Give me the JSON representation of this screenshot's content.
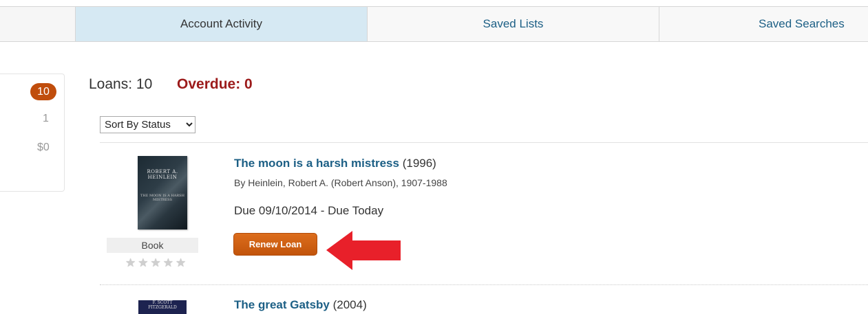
{
  "tabs": {
    "account_activity": "Account Activity",
    "saved_lists": "Saved Lists",
    "saved_searches": "Saved Searches"
  },
  "summary": {
    "loans_badge": "10",
    "holds": "1",
    "fines": "$0"
  },
  "loans_header": {
    "loans": "Loans: 10",
    "overdue": "Overdue: 0"
  },
  "sort": {
    "selected": "Sort By Status"
  },
  "items": [
    {
      "title": "The moon is a harsh mistress",
      "year": "(1996)",
      "author": "By Heinlein, Robert A. (Robert Anson), 1907-1988",
      "due": "Due 09/10/2014 - Due Today",
      "format": "Book",
      "rating": 0,
      "cover_author": "ROBERT A. HEINLEIN",
      "cover_title": "THE MOON IS A HARSH MISTRESS",
      "renew_label": "Renew Loan"
    },
    {
      "title": "The great Gatsby",
      "year": "(2004)",
      "cover_author": "F. SCOTT FITZGERALD"
    }
  ],
  "colors": {
    "accent_orange": "#c2540b",
    "link_blue": "#1c5f85",
    "overdue_red": "#9c1b1b",
    "active_tab": "#d6e9f3",
    "arrow_red": "#e8202a"
  },
  "icons": {
    "rating": "star-icon",
    "pointer": "arrow-left-icon"
  }
}
